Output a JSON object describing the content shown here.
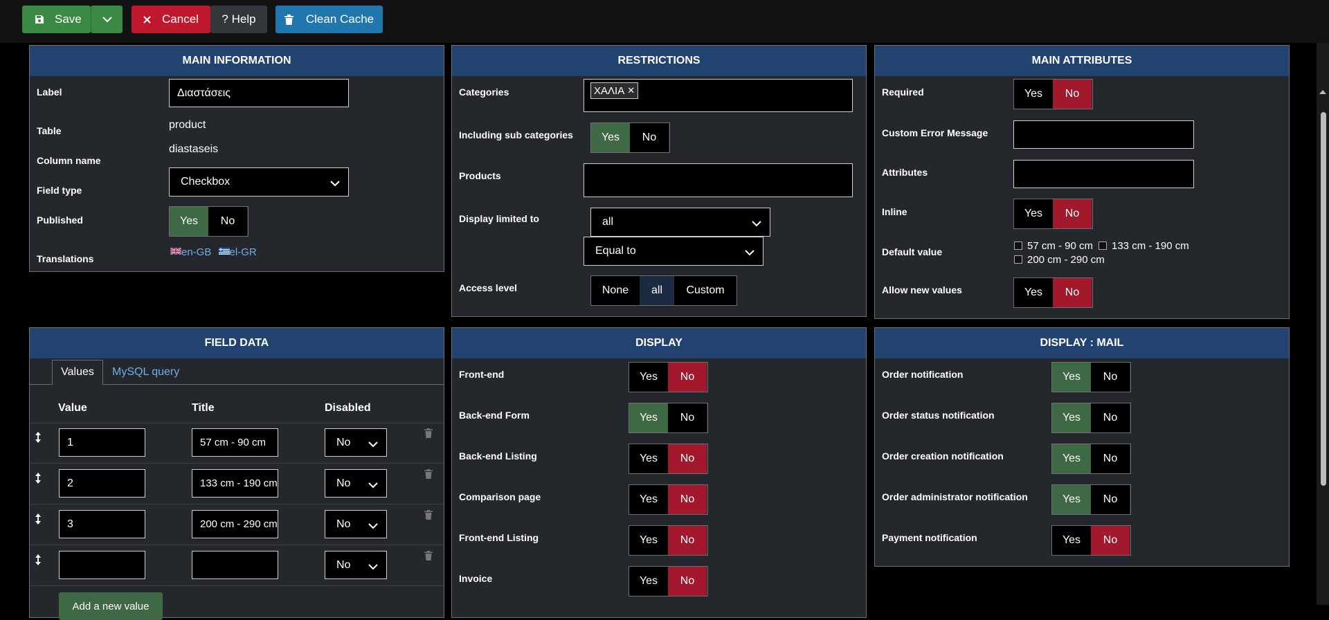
{
  "toolbar": {
    "save_label": "Save",
    "cancel_label": "Cancel",
    "help_label": "? Help",
    "clean_cache_label": "Clean Cache"
  },
  "main_information": {
    "title": "MAIN INFORMATION",
    "label_label": "Label",
    "label_value": "Διαστάσεις",
    "table_label": "Table",
    "table_value": "product",
    "column_name_label": "Column name",
    "column_name_value": "diastaseis",
    "field_type_label": "Field type",
    "field_type_value": "Checkbox",
    "published_label": "Published",
    "published_yes": "Yes",
    "published_no": "No",
    "translations_label": "Translations",
    "translation_en": "en-GB",
    "translation_el": "el-GR"
  },
  "restrictions": {
    "title": "RESTRICTIONS",
    "categories_label": "Categories",
    "category_tag": "ΧΑΛΙΑ",
    "including_sub_label": "Including sub categories",
    "yes": "Yes",
    "no": "No",
    "products_label": "Products",
    "display_limited_label": "Display limited to",
    "display_limited_value": "all",
    "operator_value": "Equal to",
    "access_level_label": "Access level",
    "access_none": "None",
    "access_all": "all",
    "access_custom": "Custom"
  },
  "main_attributes": {
    "title": "MAIN ATTRIBUTES",
    "required_label": "Required",
    "custom_error_label": "Custom Error Message",
    "attributes_label": "Attributes",
    "inline_label": "Inline",
    "default_value_label": "Default value",
    "default_options": [
      "57 cm - 90 cm",
      "133 cm - 190 cm",
      "200 cm - 290 cm"
    ],
    "allow_new_label": "Allow new values",
    "yes": "Yes",
    "no": "No"
  },
  "field_data": {
    "title": "FIELD DATA",
    "tab_values": "Values",
    "tab_mysql": "MySQL query",
    "col_value": "Value",
    "col_title": "Title",
    "col_disabled": "Disabled",
    "rows": [
      {
        "value": "1",
        "title": "57 cm - 90 cm",
        "disabled": "No"
      },
      {
        "value": "2",
        "title": "133 cm - 190 cm",
        "disabled": "No"
      },
      {
        "value": "3",
        "title": "200 cm - 290 cm",
        "disabled": "No"
      },
      {
        "value": "",
        "title": "",
        "disabled": "No"
      }
    ],
    "add_button": "Add a new value"
  },
  "display": {
    "title": "DISPLAY",
    "frontend_label": "Front-end",
    "backend_form_label": "Back-end Form",
    "backend_listing_label": "Back-end Listing",
    "comparison_label": "Comparison page",
    "frontend_listing_label": "Front-end Listing",
    "invoice_label": "Invoice",
    "yes": "Yes",
    "no": "No"
  },
  "display_mail": {
    "title": "DISPLAY : MAIL",
    "order_notification_label": "Order notification",
    "order_status_label": "Order status notification",
    "order_creation_label": "Order creation notification",
    "order_admin_label": "Order administrator notification",
    "payment_label": "Payment notification",
    "yes": "Yes",
    "no": "No"
  },
  "colors": {
    "panel_header": "#22436f",
    "panel_body": "#24272b",
    "yes_active": "#3f6845",
    "no_active": "#a2192d",
    "save_button": "#3a8a45",
    "cancel_button": "#c0182f",
    "clean_cache_button": "#2077ae",
    "link": "#6fb0e8"
  }
}
